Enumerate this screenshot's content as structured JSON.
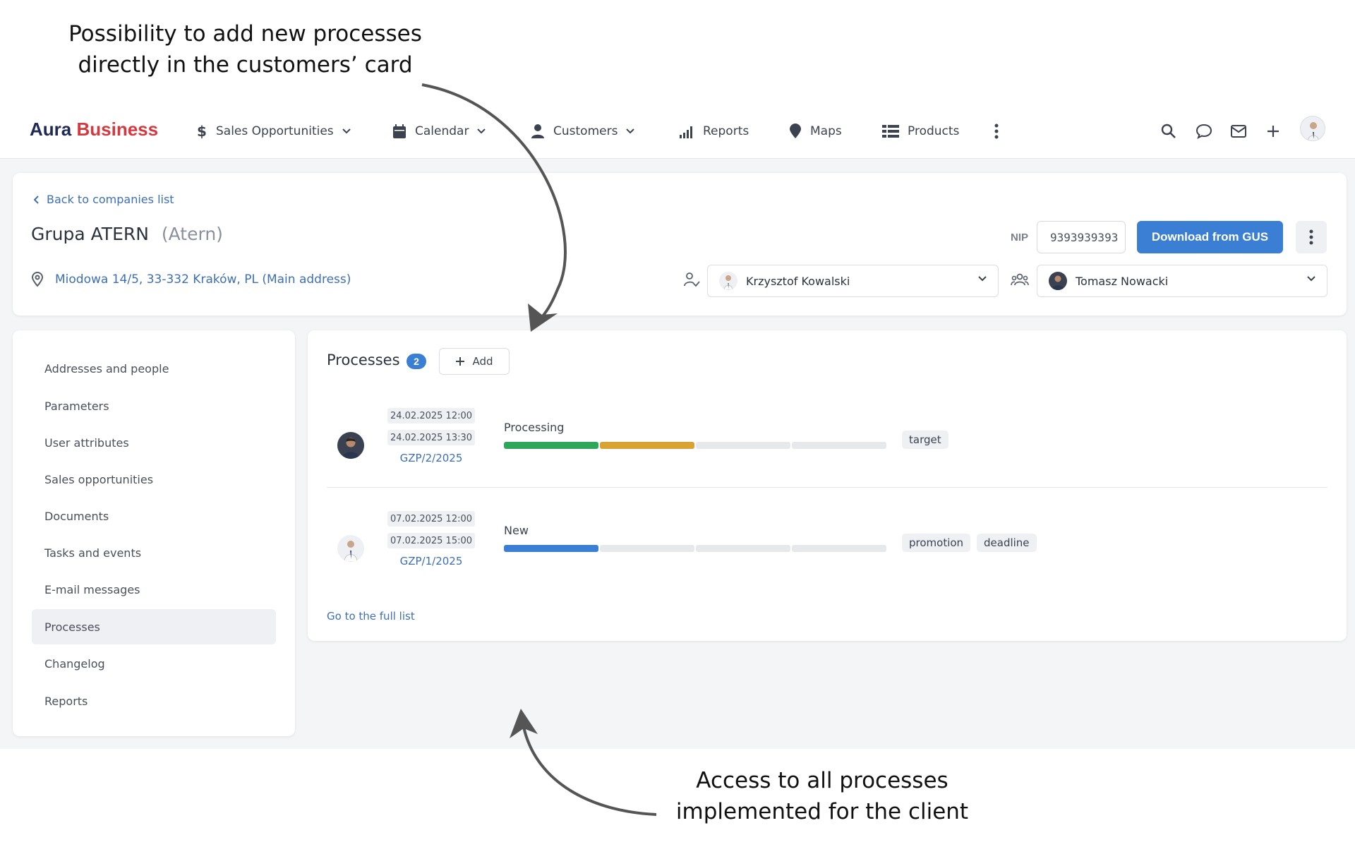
{
  "annotations": {
    "top_line1": "Possibility to add new processes",
    "top_line2": "directly in the customers’ card",
    "bottom_line1": "Access to all processes",
    "bottom_line2": "implemented for the client"
  },
  "nav": {
    "logo_part1": "Aura",
    "logo_part2": "Business",
    "items": [
      {
        "label": "Sales Opportunities",
        "icon": "dollar-icon"
      },
      {
        "label": "Calendar",
        "icon": "calendar-icon"
      },
      {
        "label": "Customers",
        "icon": "person-icon"
      },
      {
        "label": "Reports",
        "icon": "signal-bars-icon"
      },
      {
        "label": "Maps",
        "icon": "map-pin-icon"
      },
      {
        "label": "Products",
        "icon": "list-grid-icon"
      }
    ]
  },
  "company": {
    "back_label": "Back to companies list",
    "name": "Grupa ATERN",
    "short": "(Atern)",
    "address": "Miodowa 14/5, 33-332 Kraków, PL (Main address)",
    "nip_label": "NIP",
    "nip_value": "9393939393",
    "gus_button": "Download from GUS",
    "owner": "Krzysztof Kowalski",
    "team_member": "Tomasz Nowacki"
  },
  "sidebar": {
    "items": [
      {
        "label": "Addresses and people"
      },
      {
        "label": "Parameters"
      },
      {
        "label": "User attributes"
      },
      {
        "label": "Sales opportunities"
      },
      {
        "label": "Documents"
      },
      {
        "label": "Tasks and events"
      },
      {
        "label": "E-mail messages"
      },
      {
        "label": "Processes"
      },
      {
        "label": "Changelog"
      },
      {
        "label": "Reports"
      }
    ],
    "active": "Processes"
  },
  "processes": {
    "title": "Processes",
    "count": "2",
    "add_label": "Add",
    "full_list_label": "Go to the full list",
    "rows": [
      {
        "date_start": "24.02.2025 12:00",
        "date_end": "24.02.2025 13:30",
        "code": "GZP/2/2025",
        "status": "Processing",
        "stages_completed": 2,
        "stages_total": 4,
        "tags": [
          "target"
        ]
      },
      {
        "date_start": "07.02.2025 12:00",
        "date_end": "07.02.2025 15:00",
        "code": "GZP/1/2025",
        "status": "New",
        "stages_completed": 1,
        "stages_total": 4,
        "tags": [
          "promotion",
          "deadline"
        ]
      }
    ]
  },
  "colors": {
    "accent": "#3a7fd4",
    "logo_dark": "#1f2a55",
    "logo_red": "#d6383e",
    "stage_green": "#2fa75a",
    "stage_yellow": "#d9a331",
    "stage_blue": "#3a7fd4",
    "stage_empty": "#e6e8ec"
  }
}
